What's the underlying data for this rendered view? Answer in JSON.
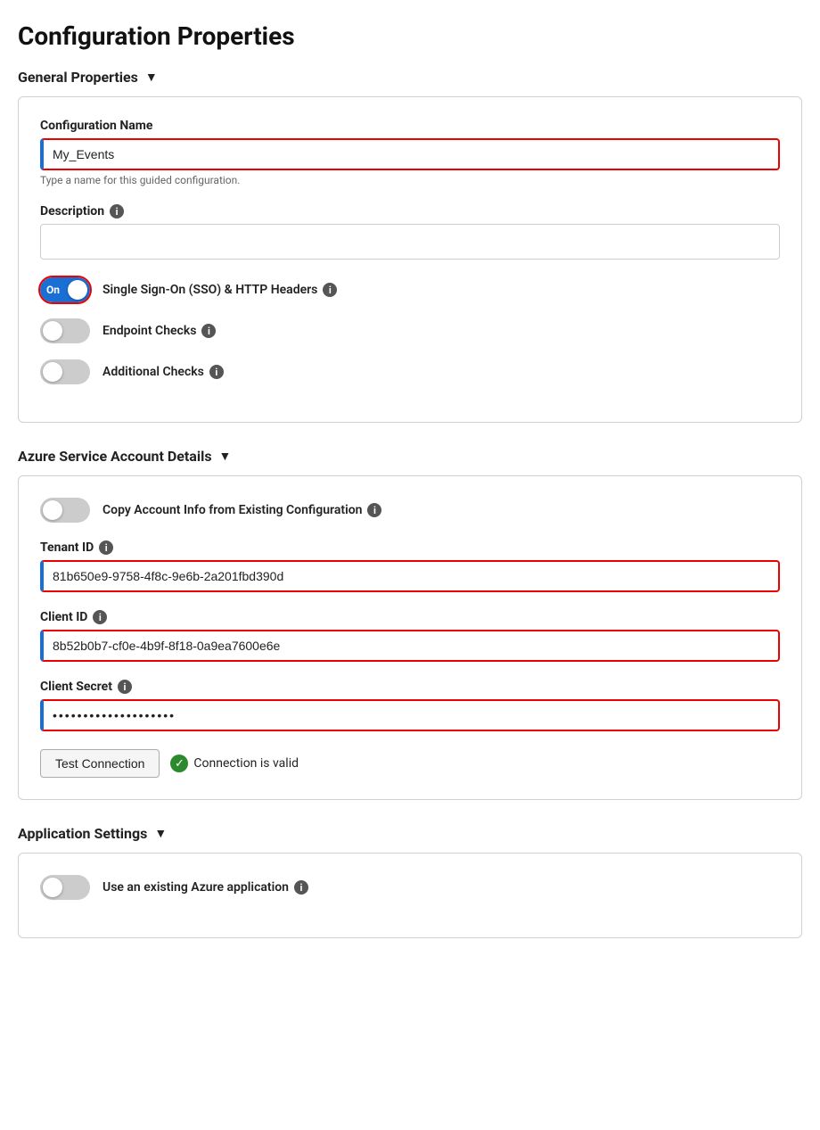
{
  "page": {
    "title": "Configuration Properties"
  },
  "general_properties": {
    "header": "General Properties",
    "chevron": "▼",
    "config_name": {
      "label": "Configuration Name",
      "value": "My_Events",
      "hint": "Type a name for this guided configuration."
    },
    "description": {
      "label": "Description",
      "value": ""
    },
    "sso_toggle": {
      "label": "Single Sign-On (SSO) & HTTP Headers",
      "state": "on",
      "state_text": "On"
    },
    "endpoint_toggle": {
      "label": "Endpoint Checks",
      "state": "off"
    },
    "additional_toggle": {
      "label": "Additional Checks",
      "state": "off"
    }
  },
  "azure_service": {
    "header": "Azure Service Account Details",
    "chevron": "▼",
    "copy_account_toggle": {
      "label": "Copy Account Info from Existing Configuration",
      "state": "off"
    },
    "tenant_id": {
      "label": "Tenant ID",
      "value": "81b650e9-9758-4f8c-9e6b-2a201fbd390d"
    },
    "client_id": {
      "label": "Client ID",
      "value": "8b52b0b7-cf0e-4b9f-8f18-0a9ea7600e6e"
    },
    "client_secret": {
      "label": "Client Secret",
      "value": "••••••••••••••••••••••••••••"
    },
    "test_button": "Test Connection",
    "connection_status": "Connection is valid"
  },
  "application_settings": {
    "header": "Application Settings",
    "chevron": "▼",
    "use_existing_toggle": {
      "label": "Use an existing Azure application",
      "state": "off"
    }
  }
}
